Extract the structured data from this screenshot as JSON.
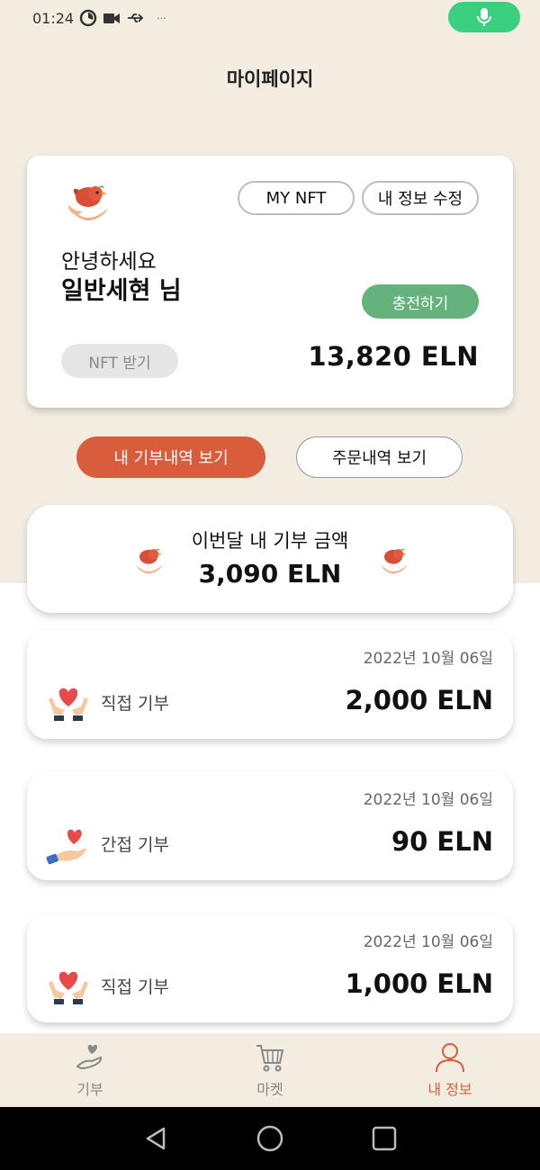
{
  "status_bar": {
    "time": "01:24",
    "dots": "···"
  },
  "header": {
    "title": "마이페이지"
  },
  "profile": {
    "my_nft_label": "MY NFT",
    "edit_label": "내 정보 수정",
    "greeting": "안녕하세요",
    "username": "일반세현  님",
    "charge_label": "충전하기",
    "nft_get_label": "NFT 받기",
    "balance": "13,820  ELN"
  },
  "tabs": {
    "donation_history": "내 기부내역 보기",
    "order_history": "주문내역 보기"
  },
  "monthly": {
    "label": "이번달 내 기부 금액",
    "amount": "3,090 ELN"
  },
  "records": [
    {
      "date": "2022년 10월 06일",
      "type": "직접 기부",
      "amount": "2,000 ELN",
      "icon": "hands-heart-icon"
    },
    {
      "date": "2022년 10월 06일",
      "type": "간접 기부",
      "amount": "90 ELN",
      "icon": "hand-heart-icon"
    },
    {
      "date": "2022년 10월 06일",
      "type": "직접 기부",
      "amount": "1,000 ELN",
      "icon": "hands-heart-icon"
    }
  ],
  "bottom_nav": {
    "items": [
      {
        "label": "기부",
        "icon": "donate-hand-icon"
      },
      {
        "label": "마켓",
        "icon": "cart-icon"
      },
      {
        "label": "내 정보",
        "icon": "person-icon"
      }
    ],
    "active_index": 2
  },
  "colors": {
    "beige_bg": "#f2ede0",
    "accent_orange": "#d95d3d",
    "charge_green": "#66b27c",
    "mic_green": "#3ad07f"
  }
}
